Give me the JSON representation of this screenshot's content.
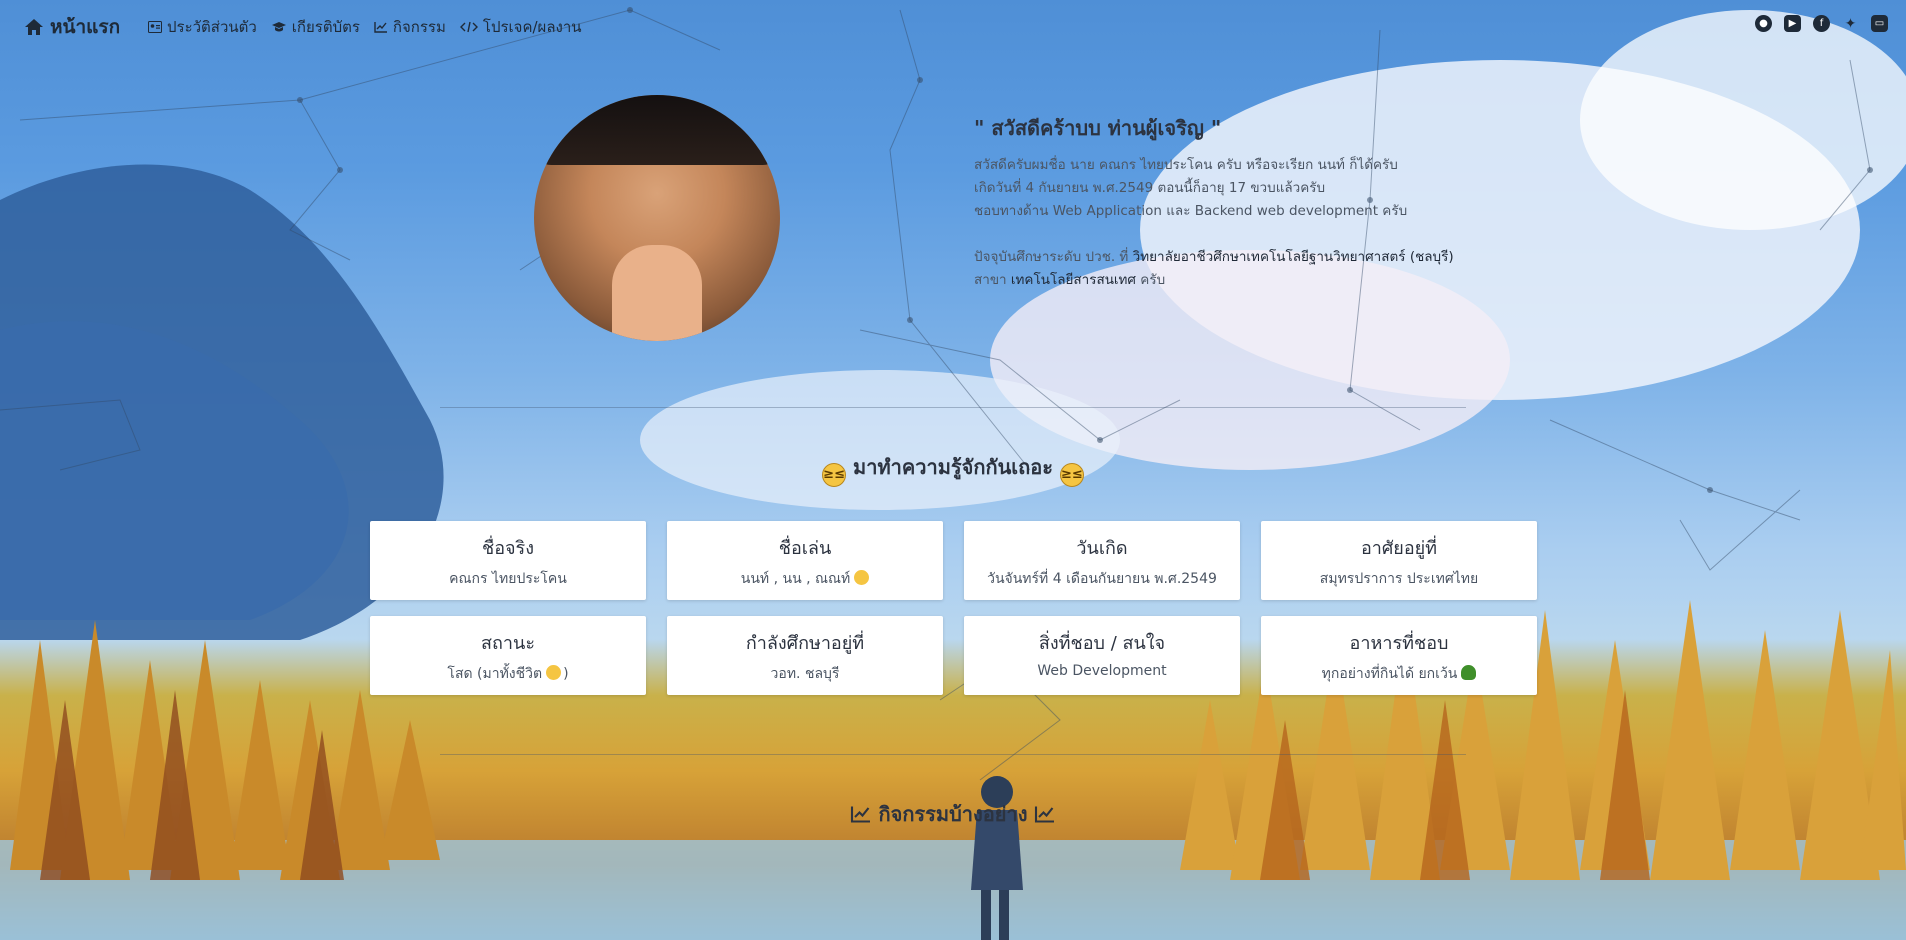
{
  "nav": {
    "brand": "หน้าแรก",
    "links": [
      {
        "label": "ประวัติส่วนตัว",
        "icon": "id-card-icon"
      },
      {
        "label": "เกียรติบัตร",
        "icon": "graduation-cap-icon"
      },
      {
        "label": "กิจกรรม",
        "icon": "chart-line-icon"
      },
      {
        "label": "โปรเจค/ผลงาน",
        "icon": "code-icon"
      }
    ],
    "social": [
      "github-icon",
      "youtube-icon",
      "facebook-icon",
      "twitter-icon",
      "wallet-icon"
    ]
  },
  "hero": {
    "greeting": "\" สวัสดีคร้าบบ ท่านผู้เจริญ \"",
    "line1": "สวัสดีครับผมชื่อ นาย คณกร ไทยประโคน ครับ หรือจะเรียก นนท์ ก็ได้ครับ",
    "line2": "เกิดวันที่ 4 กันยายน พ.ศ.2549 ตอนนี้ก็อายุ 17 ขวบแล้วครับ",
    "line3": "ชอบทางด้าน Web Application และ Backend web development ครับ",
    "line4_prefix": "ปัจจุบันศึกษาระดับ ปวช. ที่ ",
    "line4_school": "วิทยาลัยอาชีวศึกษาเทคโนโลยีฐานวิทยาศาสตร์ (ชลบุรี)",
    "line5_prefix": "สาขา ",
    "line5_major": "เทคโนโลยีสารสนเทศ",
    "line5_suffix": " ครับ"
  },
  "about": {
    "title": "มาทำความรู้จักกันเถอะ",
    "cards": [
      {
        "title": "ชื่อจริง",
        "value": "คณกร ไทยประโคน"
      },
      {
        "title": "ชื่อเล่น",
        "value": "นนท์ , นน , ณณท์"
      },
      {
        "title": "วันเกิด",
        "value": "วันจันทร์ที่ 4 เดือนกันยายน พ.ศ.2549"
      },
      {
        "title": "อาศัยอยู่ที่",
        "value": "สมุทรปราการ ประเทศไทย"
      },
      {
        "title": "สถานะ",
        "value": "โสด (มาทั้งชีวิต",
        "suffix": ")"
      },
      {
        "title": "กำลังศึกษาอยู่ที่",
        "value": "วอท. ชลบุรี"
      },
      {
        "title": "สิ่งที่ชอบ / สนใจ",
        "value": "Web Development"
      },
      {
        "title": "อาหารที่ชอบ",
        "value": "ทุกอย่างที่กินได้ ยกเว้น"
      }
    ]
  },
  "activity": {
    "title": "กิจกรรมบ้างอย่าง"
  }
}
